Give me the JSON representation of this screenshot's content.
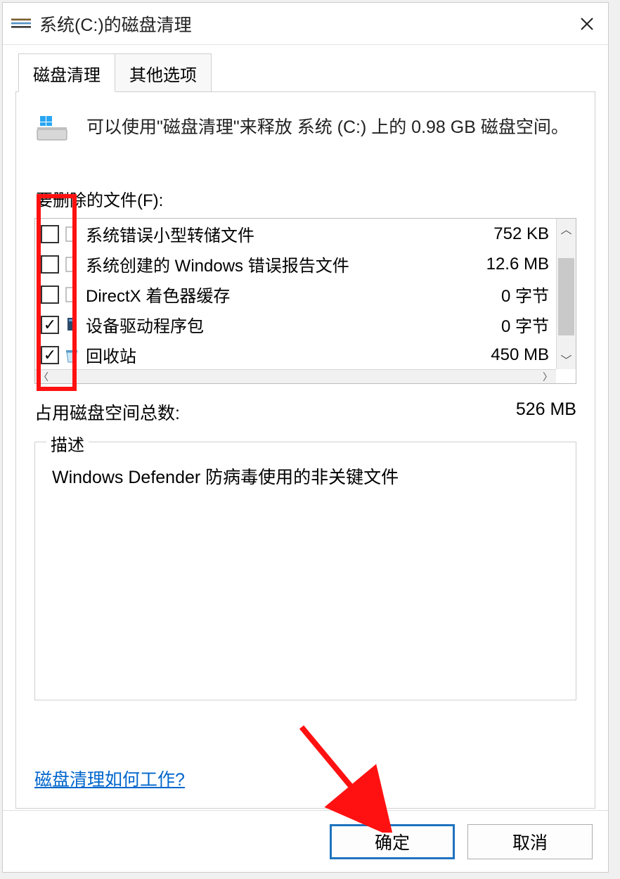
{
  "window": {
    "title": "系统(C:)的磁盘清理"
  },
  "tabs": {
    "cleanup": "磁盘清理",
    "more": "其他选项"
  },
  "intro": "可以使用\"磁盘清理\"来释放 系统 (C:) 上的 0.98 GB 磁盘空间。",
  "files_label": "要删除的文件(F):",
  "file_rows": [
    {
      "name": "系统错误小型转储文件",
      "size": "752 KB",
      "checked": false,
      "icon": "file"
    },
    {
      "name": "系统创建的 Windows 错误报告文件",
      "size": "12.6 MB",
      "checked": false,
      "icon": "file"
    },
    {
      "name": "DirectX 着色器缓存",
      "size": "0 字节",
      "checked": false,
      "icon": "file"
    },
    {
      "name": "设备驱动程序包",
      "size": "0 字节",
      "checked": true,
      "icon": "device"
    },
    {
      "name": "回收站",
      "size": "450 MB",
      "checked": true,
      "icon": "recycle"
    }
  ],
  "total": {
    "label": "占用磁盘空间总数:",
    "value": "526 MB"
  },
  "description": {
    "legend": "描述",
    "text": "Windows Defender 防病毒使用的非关键文件"
  },
  "help_link": "磁盘清理如何工作?",
  "buttons": {
    "ok": "确定",
    "cancel": "取消"
  }
}
